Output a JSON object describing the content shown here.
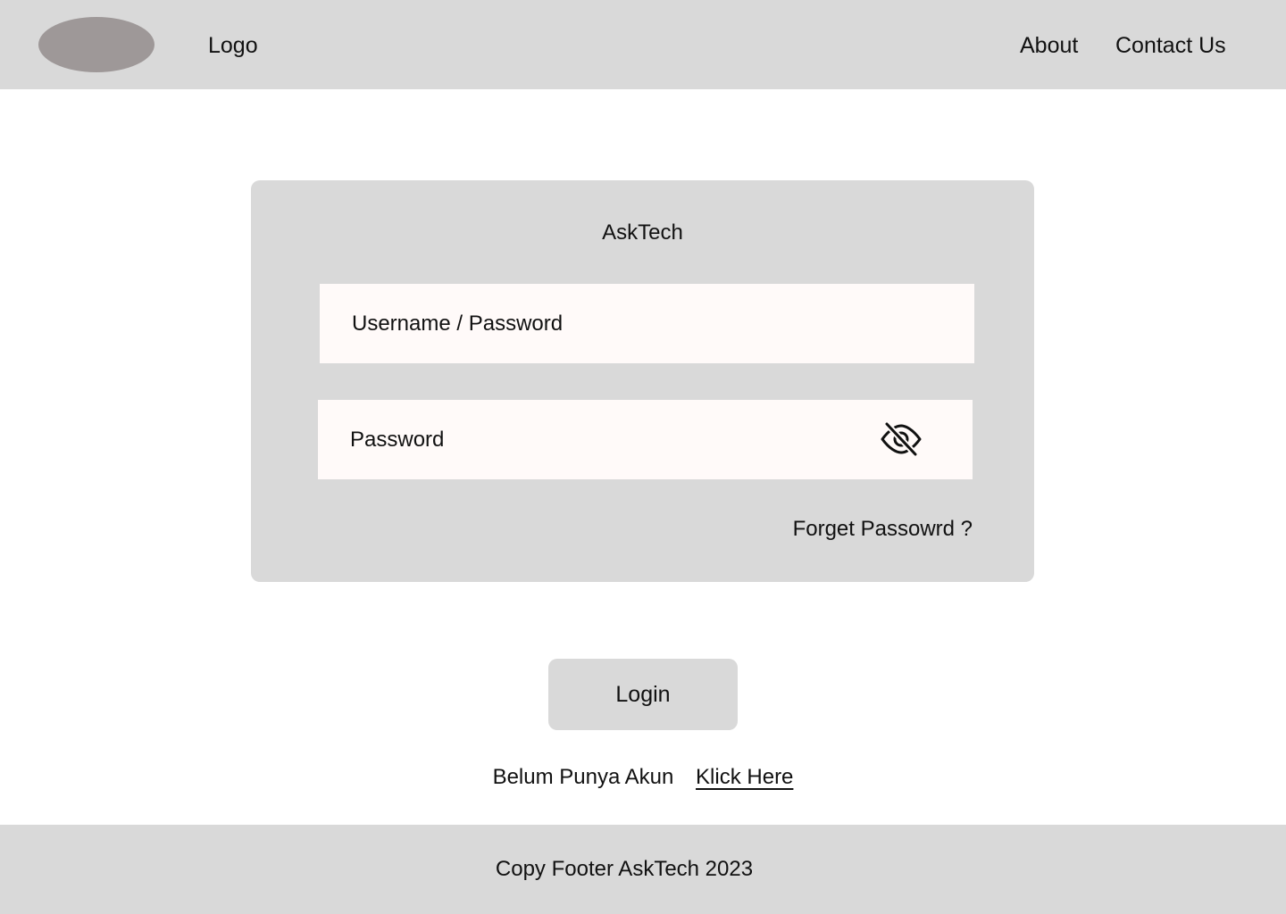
{
  "header": {
    "logo_text": "Logo",
    "nav": {
      "about": "About",
      "contact": "Contact Us"
    }
  },
  "login_card": {
    "title": "AskTech",
    "username_field": {
      "placeholder": "Username / Password"
    },
    "password_field": {
      "placeholder": "Password",
      "toggle_icon": "eye-off-icon"
    },
    "forgot_password": "Forget Passowrd ?"
  },
  "login_button": {
    "label": "Login"
  },
  "register": {
    "text": "Belum Punya Akun",
    "link": "Klick Here"
  },
  "footer": {
    "text": "Copy Footer AskTech 2023"
  },
  "colors": {
    "panel_gray": "#d9d9d9",
    "logo_oval": "#9e9898",
    "input_bg": "#fffaf9",
    "text": "#111111"
  }
}
